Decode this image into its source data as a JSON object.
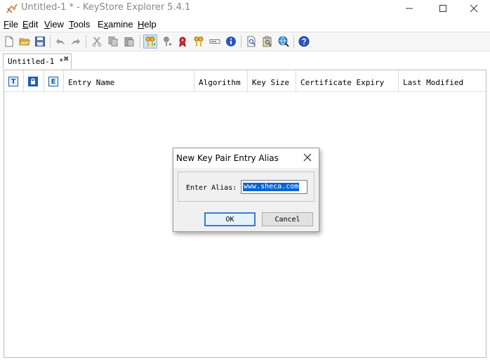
{
  "window": {
    "title": "Untitled-1 * - KeyStore Explorer 5.4.1",
    "icon": "keystore-explorer-app-icon",
    "controls": [
      "minimize-icon",
      "maximize-icon",
      "close-icon"
    ]
  },
  "menubar": {
    "items": [
      {
        "label": "File",
        "mnemonic": "F",
        "rest": "ile"
      },
      {
        "label": "Edit",
        "mnemonic": "E",
        "rest": "dit"
      },
      {
        "label": "View",
        "mnemonic": "V",
        "rest": "iew"
      },
      {
        "label": "Tools",
        "mnemonic": "T",
        "rest": "ools"
      },
      {
        "label": "Examine",
        "mnemonic": "x",
        "prefix": "E",
        "rest": "amine"
      },
      {
        "label": "Help",
        "mnemonic": "H",
        "rest": "elp"
      }
    ]
  },
  "toolbar": {
    "buttons": [
      "new-file-icon",
      "open-folder-icon",
      "save-icon",
      "undo-icon",
      "redo-icon",
      "cut-icon",
      "copy-icon",
      "paste-icon",
      "generate-key-pair-icon",
      "generate-secret-key-icon",
      "import-trusted-certificate-icon",
      "import-key-pair-icon",
      "set-password-icon",
      "properties-icon",
      "examine-file-icon",
      "examine-clipboard-icon",
      "examine-ssl-icon",
      "help-icon"
    ],
    "active": "generate-key-pair-icon"
  },
  "tabs": [
    {
      "label": "Untitled-1 *",
      "close": "✖"
    }
  ],
  "table": {
    "icon_columns": [
      "T",
      "L",
      "E"
    ],
    "columns": [
      "Entry Name",
      "Algorithm",
      "Key Size",
      "Certificate Expiry",
      "Last Modified"
    ],
    "rows": []
  },
  "dialog": {
    "title": "New Key Pair Entry Alias",
    "alias_label": "Enter Alias:",
    "alias_value": "www.sheca.com",
    "ok_label": "OK",
    "cancel_label": "Cancel"
  }
}
